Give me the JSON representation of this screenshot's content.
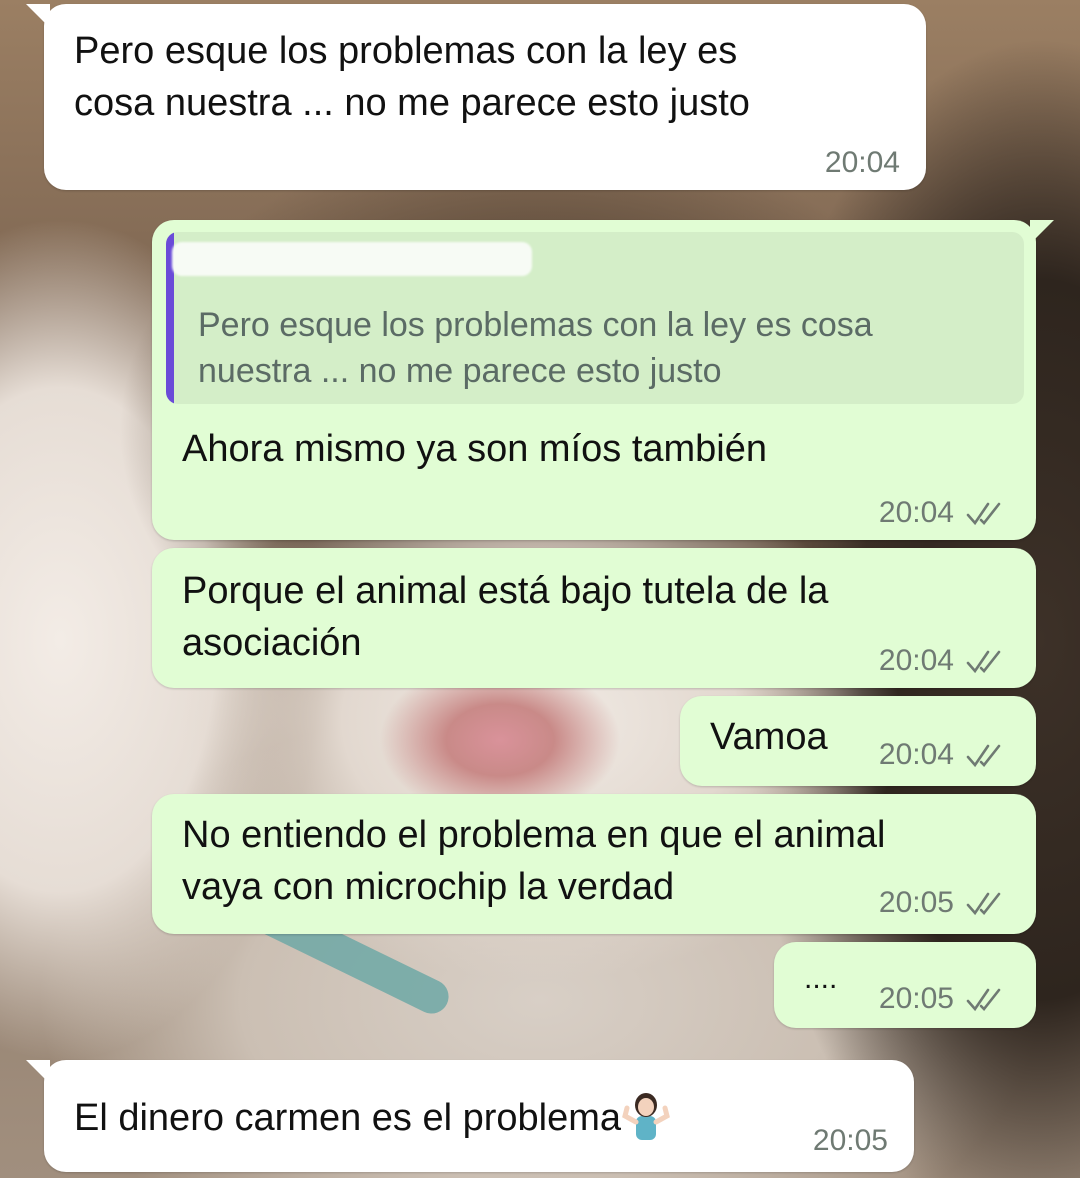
{
  "messages": [
    {
      "direction": "incoming",
      "text_lines": [
        "Pero esque los problemas con la ley es",
        "cosa nuestra ... no me parece esto justo"
      ],
      "time": "20:04"
    },
    {
      "direction": "outgoing",
      "quote": {
        "author": "",
        "text_lines": [
          "Pero esque los problemas con la ley es cosa",
          "nuestra ... no me parece esto justo"
        ]
      },
      "text_lines": [
        "Ahora mismo ya son míos también"
      ],
      "time": "20:04",
      "status": "read-double-check"
    },
    {
      "direction": "outgoing",
      "text_lines": [
        "Porque el animal está bajo tutela de la",
        "asociación"
      ],
      "time": "20:04",
      "status": "read-double-check"
    },
    {
      "direction": "outgoing",
      "text_lines": [
        "Vamoa"
      ],
      "time": "20:04",
      "status": "read-double-check"
    },
    {
      "direction": "outgoing",
      "text_lines": [
        "No entiendo el problema en que el animal",
        "vaya con microchip la verdad"
      ],
      "time": "20:05",
      "status": "read-double-check"
    },
    {
      "direction": "outgoing",
      "text_lines": [
        "...."
      ],
      "time": "20:05",
      "status": "read-double-check"
    },
    {
      "direction": "incoming",
      "text_lines": [
        "El dinero carmen es el problema"
      ],
      "emoji": "person-shrugging-emoji",
      "time": "20:05"
    }
  ],
  "colors": {
    "incoming_bubble": "#ffffff",
    "outgoing_bubble": "#e1fdd4",
    "quote_bar": "#6a4bd8",
    "tick": "#6f7a73"
  }
}
